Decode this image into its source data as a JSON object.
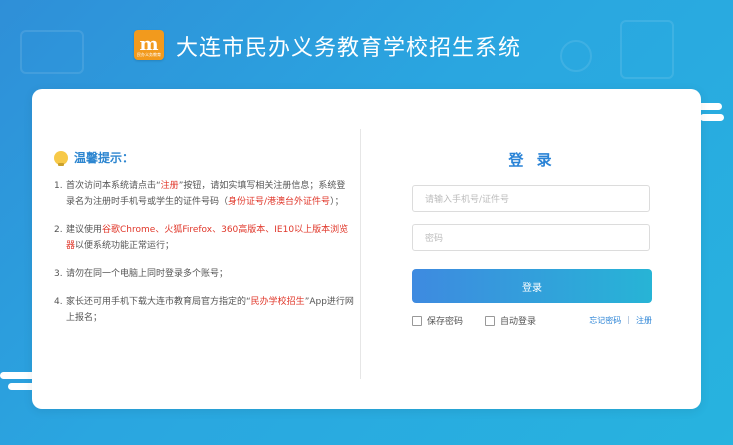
{
  "app": {
    "logo_letter": "m",
    "logo_caption": "民办义务教育",
    "title": "大连市民办义务教育学校招生系统"
  },
  "tips": {
    "title": "温馨提示：",
    "items": [
      {
        "num": "1.",
        "segments": [
          {
            "text": "首次访问本系统请点击“",
            "red": false
          },
          {
            "text": "注册",
            "red": true
          },
          {
            "text": "”按钮，请如实填写相关注册信息；系统登录名为注册时手机号或学生的证件号码（",
            "red": false
          },
          {
            "text": "身份证号/港澳台外证件号",
            "red": true
          },
          {
            "text": "）；",
            "red": false
          }
        ]
      },
      {
        "num": "2.",
        "segments": [
          {
            "text": "建议使用",
            "red": false
          },
          {
            "text": "谷歌Chrome、火狐Firefox、360高版本、IE10以上版本浏览器",
            "red": true
          },
          {
            "text": "以便系统功能正常运行；",
            "red": false
          }
        ]
      },
      {
        "num": "3.",
        "segments": [
          {
            "text": "请勿在同一个电脑上同时登录多个账号；",
            "red": false
          }
        ]
      },
      {
        "num": "4.",
        "segments": [
          {
            "text": "家长还可用手机下载大连市教育局官方指定的“",
            "red": false
          },
          {
            "text": "民办学校招生",
            "red": true
          },
          {
            "text": "”App进行网上报名；",
            "red": false
          }
        ]
      }
    ]
  },
  "login": {
    "title": "登 录",
    "username_placeholder": "请输入手机号/证件号",
    "password_placeholder": "密码",
    "submit_label": "登录",
    "save_password_label": "保存密码",
    "auto_login_label": "自动登录",
    "forgot_label": "忘记密码",
    "separator": "|",
    "register_label": "注册"
  },
  "colors": {
    "accent": "#2a83d6",
    "warning_red": "#e0372a",
    "logo_orange": "#f29a1d"
  }
}
